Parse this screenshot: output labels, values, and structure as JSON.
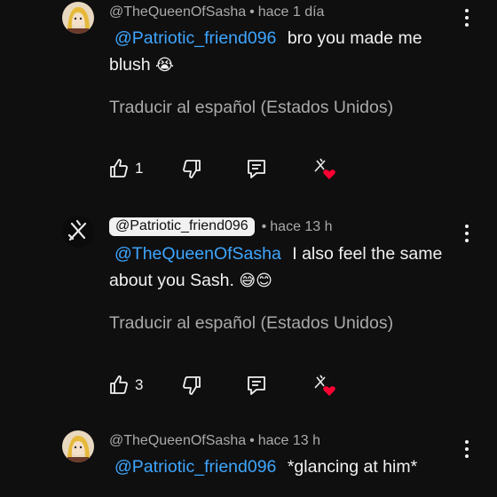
{
  "comments": [
    {
      "author": "@TheQueenOfSasha",
      "time": "hace 1 día",
      "mention": "@Patriotic_friend096",
      "text_line1": "bro you made me",
      "text_line2": "blush",
      "emoji": "😭",
      "translate": "Traducir al español (Estados Unidos)",
      "likes": "1"
    },
    {
      "author": "@Patriotic_friend096",
      "time": "hace 13 h",
      "mention": "@TheQueenOfSasha",
      "text_line1": "I also feel the same",
      "text_line2": "about you Sash.",
      "emoji": "😅😊",
      "translate": "Traducir al español (Estados Unidos)",
      "likes": "3"
    },
    {
      "author": "@TheQueenOfSasha",
      "time": "hace 13 h",
      "mention": "@Patriotic_friend096",
      "text_line1": "*glancing at him*"
    }
  ],
  "separator": "•",
  "icons": {
    "like": "thumbs-up-icon",
    "dislike": "thumbs-down-icon",
    "reply": "reply-icon",
    "creator_heart": "creator-heart-icon",
    "more": "more-vert-icon"
  },
  "colors": {
    "background": "#0f0f0f",
    "mention": "#3ea6ff",
    "secondary_text": "#aaaaaa",
    "heart": "#ff0033"
  }
}
